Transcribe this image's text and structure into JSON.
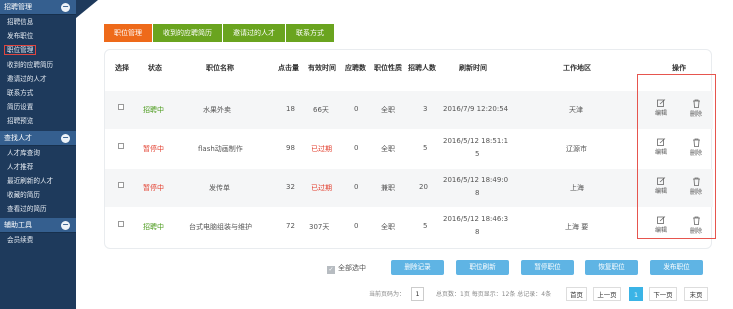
{
  "sidebar": {
    "group1": {
      "title": "招聘管理",
      "items": [
        "招聘信息",
        "发布职位",
        "职位管理",
        "收到的应聘简历",
        "邀请过的人才",
        "联系方式",
        "简历设置",
        "招聘预览"
      ]
    },
    "group2": {
      "title": "查找人才",
      "items": [
        "人才库查询",
        "人才推荐",
        "最近刷新的人才",
        "收藏的简历",
        "查看过的简历"
      ]
    },
    "group3": {
      "title": "辅助工具",
      "items": [
        "会员续费"
      ]
    },
    "toggle": "−"
  },
  "tabs": [
    "职位管理",
    "收到的应聘简历",
    "邀请过的人才",
    "联系方式"
  ],
  "table": {
    "headers": [
      "选择",
      "状态",
      "职位名称",
      "点击量",
      "有效时间",
      "应聘数",
      "职位性质",
      "招聘人数",
      "刷新时间",
      "工作地区",
      "操作"
    ],
    "rows": [
      {
        "status": "招聘中",
        "name": "水果外卖",
        "clicks": "18",
        "valid": "66天",
        "apply": "0",
        "type": "全职",
        "count": "3",
        "time1": "2016/7/9 12:20:54",
        "time2": "",
        "area": "天津"
      },
      {
        "status": "暂停中",
        "name": "flash动画制作",
        "clicks": "98",
        "valid": "已过期",
        "apply": "0",
        "type": "全职",
        "count": "5",
        "time1": "2016/5/12 18:51:1",
        "time2": "5",
        "area": "辽源市"
      },
      {
        "status": "暂停中",
        "name": "发传单",
        "clicks": "32",
        "valid": "已过期",
        "apply": "0",
        "type": "兼职",
        "count": "20",
        "time1": "2016/5/12 18:49:0",
        "time2": "8",
        "area": "上海"
      },
      {
        "status": "招聘中",
        "name": "台式电脑组装与维护",
        "clicks": "72",
        "valid": "307天",
        "apply": "0",
        "type": "全职",
        "count": "5",
        "time1": "2016/5/12 18:46:3",
        "time2": "8",
        "area": "上海 要"
      }
    ],
    "edit_label": "编辑",
    "delete_label": "删除"
  },
  "actions": {
    "select_all": "全部选中",
    "check": "✓",
    "buttons": [
      "删除记录",
      "职位刷新",
      "暂停职位",
      "恢复职位",
      "发布职位"
    ]
  },
  "pager": {
    "goto_label": "当前页码为：",
    "goto_value": "1",
    "summary": "总页数：1页 每页显示：12条 总记录：4条",
    "first": "首页",
    "prev": "上一页",
    "current": "1",
    "next": "下一页",
    "last": "末页"
  },
  "colors": {
    "sidebar": "#1e3a5c",
    "tab_active": "#ee6a1a",
    "tab": "#6aa41f",
    "button": "#5fb4e4",
    "status_active": "#4a9a1a",
    "status_paused": "#e23b2a"
  }
}
